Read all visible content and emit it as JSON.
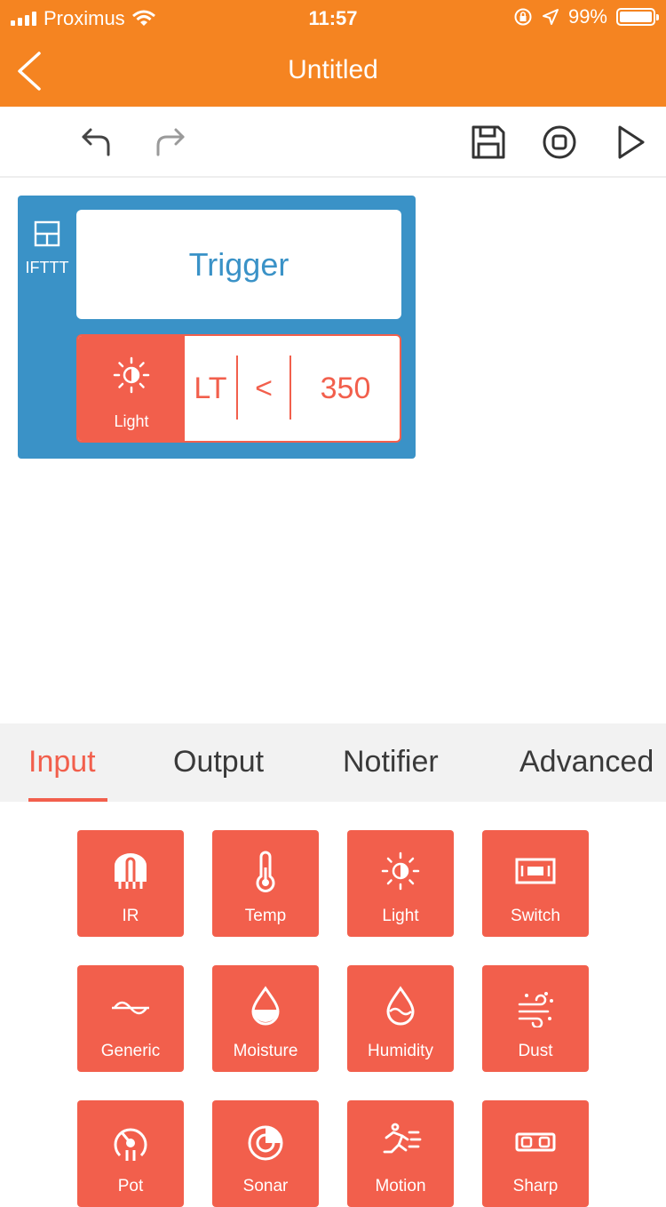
{
  "status_bar": {
    "carrier": "Proximus",
    "time": "11:57",
    "battery": "99%",
    "battery_level": 0.99
  },
  "nav": {
    "title": "Untitled"
  },
  "block": {
    "label": "IFTTT",
    "trigger_label": "Trigger",
    "condition": {
      "sensor": "Light",
      "mode": "LT",
      "operator": "<",
      "value": "350"
    }
  },
  "tabs": [
    {
      "label": "Input",
      "active": true
    },
    {
      "label": "Output",
      "active": false
    },
    {
      "label": "Notifier",
      "active": false
    },
    {
      "label": "Advanced",
      "active": false
    }
  ],
  "sensors": [
    {
      "label": "IR",
      "icon": "ir-icon"
    },
    {
      "label": "Temp",
      "icon": "thermometer-icon"
    },
    {
      "label": "Light",
      "icon": "sun-icon"
    },
    {
      "label": "Switch",
      "icon": "switch-icon"
    },
    {
      "label": "Generic",
      "icon": "wave-icon"
    },
    {
      "label": "Moisture",
      "icon": "drop-icon"
    },
    {
      "label": "Humidity",
      "icon": "humidity-drop-icon"
    },
    {
      "label": "Dust",
      "icon": "dust-icon"
    },
    {
      "label": "Pot",
      "icon": "potentiometer-icon"
    },
    {
      "label": "Sonar",
      "icon": "sonar-icon"
    },
    {
      "label": "Motion",
      "icon": "motion-icon"
    },
    {
      "label": "Sharp",
      "icon": "sharp-icon"
    }
  ],
  "colors": {
    "nav": "#f58421",
    "block": "#3a92c7",
    "accent": "#f25f4c",
    "tabs_bg": "#f2f2f2"
  }
}
